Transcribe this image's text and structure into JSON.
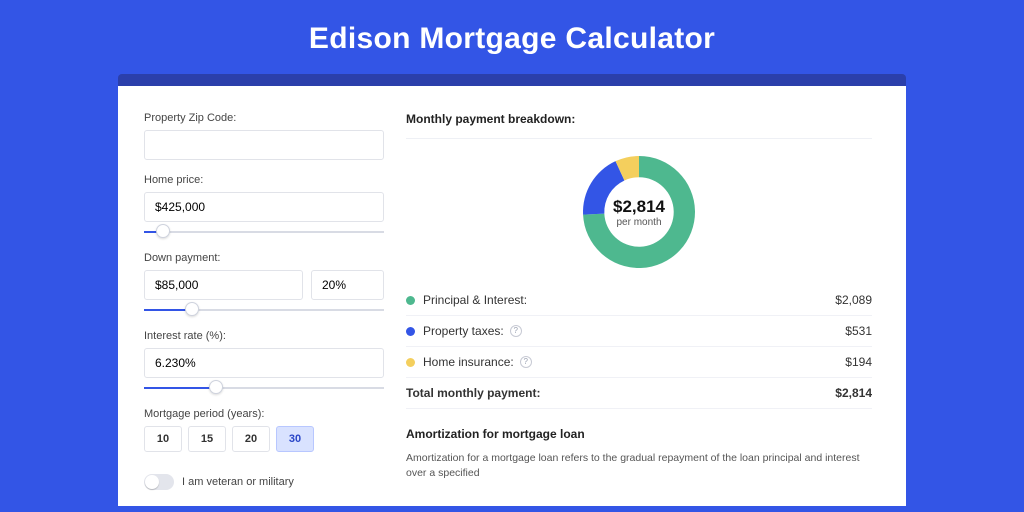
{
  "title": "Edison Mortgage Calculator",
  "form": {
    "zip_label": "Property Zip Code:",
    "zip_value": "",
    "price_label": "Home price:",
    "price_value": "$425,000",
    "price_slider_pct": 8,
    "down_label": "Down payment:",
    "down_value": "$85,000",
    "down_pct_value": "20%",
    "down_slider_pct": 20,
    "rate_label": "Interest rate (%):",
    "rate_value": "6.230%",
    "rate_slider_pct": 30,
    "period_label": "Mortgage period (years):",
    "periods": [
      {
        "label": "10",
        "active": false
      },
      {
        "label": "15",
        "active": false
      },
      {
        "label": "20",
        "active": false
      },
      {
        "label": "30",
        "active": true
      }
    ],
    "veteran_label": "I am veteran or military"
  },
  "breakdown": {
    "title": "Monthly payment breakdown:",
    "center_value": "$2,814",
    "center_label": "per month",
    "items": [
      {
        "label": "Principal & Interest:",
        "value": "$2,089",
        "color": "#4eb88f",
        "help": false
      },
      {
        "label": "Property taxes:",
        "value": "$531",
        "color": "#3355e6",
        "help": true
      },
      {
        "label": "Home insurance:",
        "value": "$194",
        "color": "#f4cf5d",
        "help": true
      }
    ],
    "total_label": "Total monthly payment:",
    "total_value": "$2,814"
  },
  "amort": {
    "title": "Amortization for mortgage loan",
    "text": "Amortization for a mortgage loan refers to the gradual repayment of the loan principal and interest over a specified"
  },
  "chart_data": {
    "type": "pie",
    "title": "Monthly payment breakdown",
    "series": [
      {
        "name": "Principal & Interest",
        "value": 2089,
        "color": "#4eb88f"
      },
      {
        "name": "Property taxes",
        "value": 531,
        "color": "#3355e6"
      },
      {
        "name": "Home insurance",
        "value": 194,
        "color": "#f4cf5d"
      }
    ],
    "total": 2814,
    "center_label": "$2,814 per month",
    "donut_inner_radius_pct": 62
  }
}
